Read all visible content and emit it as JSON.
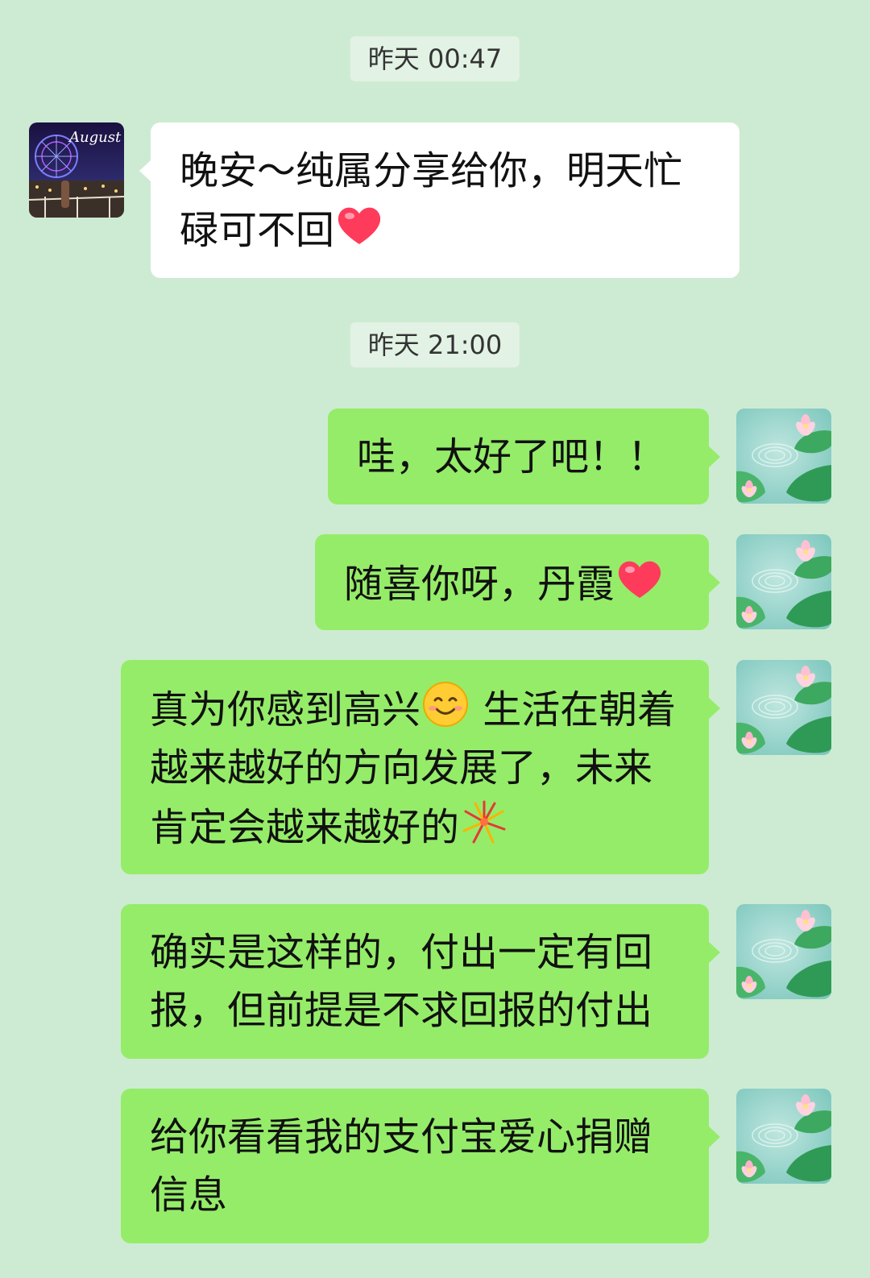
{
  "chat": {
    "timestamps": [
      "昨天 00:47",
      "昨天 21:00"
    ],
    "messages": [
      {
        "side": "in",
        "avatar_icon": "august-ferris-wheel-avatar",
        "avatar_text": "August",
        "text": "晚安～纯属分享给你，明天忙碌可不回",
        "trailing_emoji": "red-heart-icon"
      },
      {
        "side": "out",
        "avatar_icon": "lotus-pond-avatar",
        "text": "哇，太好了吧！！"
      },
      {
        "side": "out",
        "avatar_icon": "lotus-pond-avatar",
        "text": "随喜你呀，丹霞",
        "trailing_emoji": "red-heart-icon"
      },
      {
        "side": "out",
        "avatar_icon": "lotus-pond-avatar",
        "text_parts": [
          "真为你感到高兴",
          " 生活在朝着越来越好的方向发展了，未来肯定会越来越好的"
        ],
        "emojis": [
          "smiling-face-icon",
          "fireworks-icon"
        ]
      },
      {
        "side": "out",
        "avatar_icon": "lotus-pond-avatar",
        "text": "确实是这样的，付出一定有回报，但前提是不求回报的付出"
      },
      {
        "side": "out",
        "avatar_icon": "lotus-pond-avatar",
        "text": "给你看看我的支付宝爱心捐赠信息"
      }
    ]
  },
  "colors": {
    "background": "#cdebd2",
    "incoming_bubble": "#ffffff",
    "outgoing_bubble": "#95ec69",
    "timestamp_bg": "#e2f2e4"
  }
}
